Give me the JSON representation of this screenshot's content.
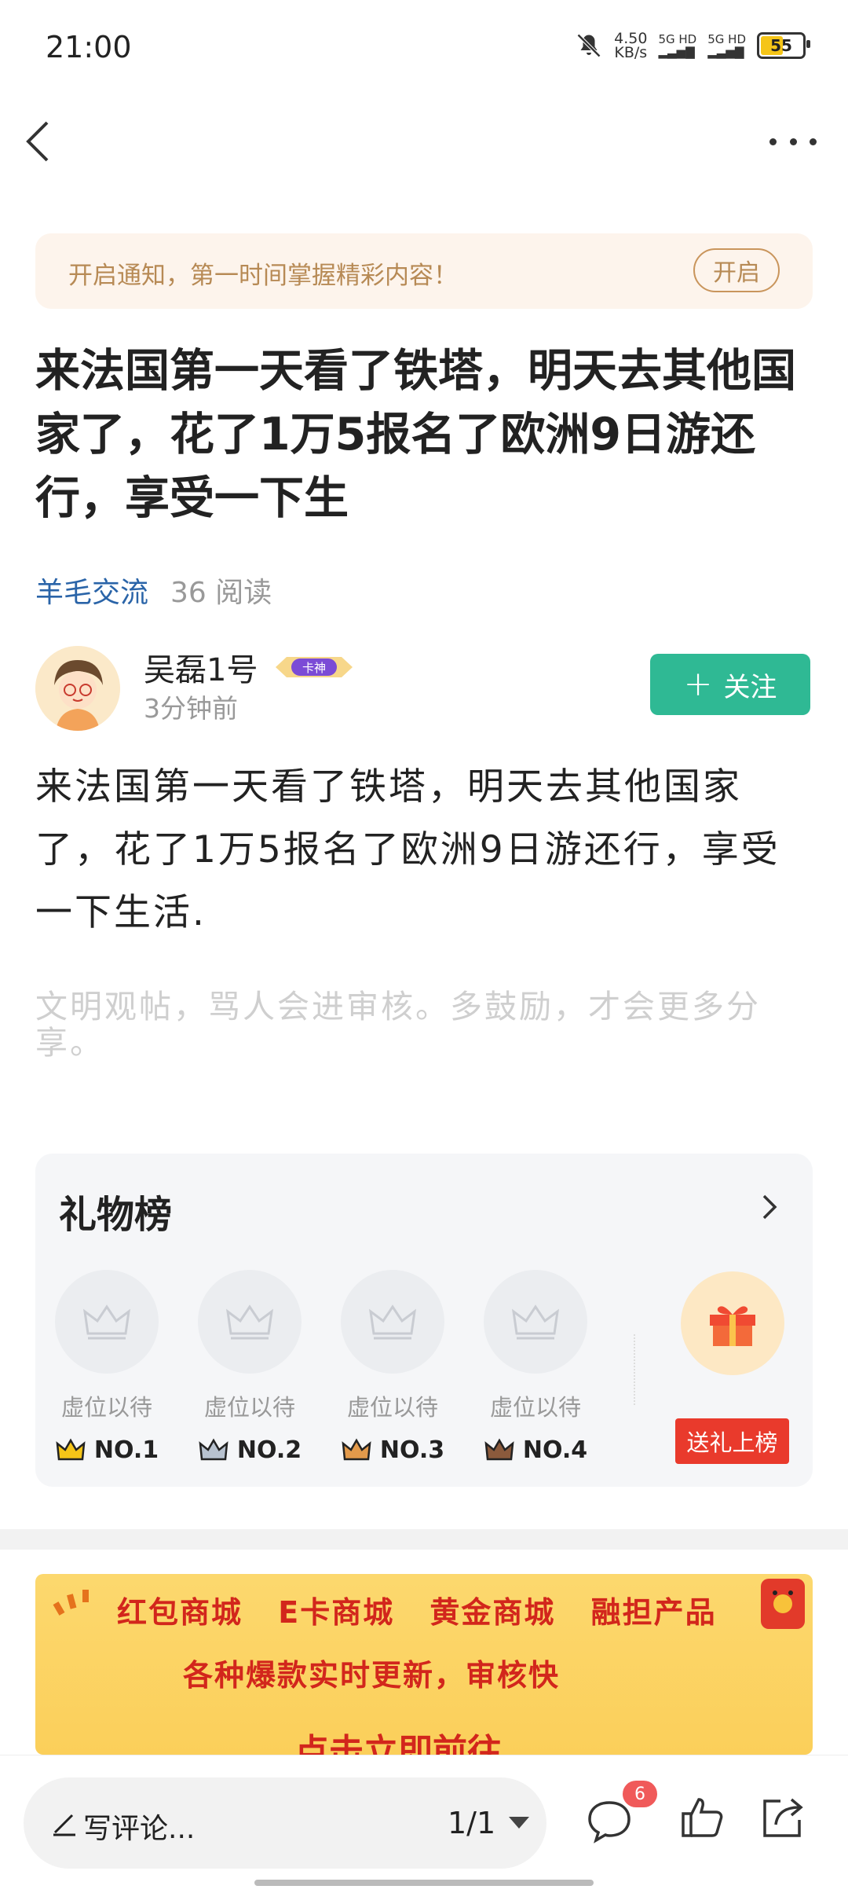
{
  "status": {
    "time": "21:00",
    "net_speed_value": "4.50",
    "net_speed_unit": "KB/s",
    "signal1": "5G HD",
    "signal2": "5G HD",
    "battery": "55"
  },
  "notify": {
    "text": "开启通知，第一时间掌握精彩内容！",
    "button": "开启"
  },
  "article": {
    "title": "来法国第一天看了铁塔，明天去其他国家了，花了1万5报名了欧洲9日游还行，享受一下生",
    "category": "羊毛交流",
    "reads": "36 阅读",
    "content": "来法国第一天看了铁塔，明天去其他国家了，花了1万5报名了欧洲9日游还行，享受一下生活.",
    "hint": "文明观帖，骂人会进审核。多鼓励，才会更多分享。"
  },
  "author": {
    "name": "吴磊1号",
    "badge": "卡神",
    "time": "3分钟前",
    "follow_label": "关注"
  },
  "gift_board": {
    "title": "礼物榜",
    "slots": [
      {
        "status": "虚位以待",
        "rank": "NO.1",
        "crown_color": "#f5c518"
      },
      {
        "status": "虚位以待",
        "rank": "NO.2",
        "crown_color": "#b8c2cf"
      },
      {
        "status": "虚位以待",
        "rank": "NO.3",
        "crown_color": "#e39a4b"
      },
      {
        "status": "虚位以待",
        "rank": "NO.4",
        "crown_color": "#8b5a3c"
      }
    ],
    "send_label": "送礼上榜"
  },
  "ad": {
    "row1": "红包商城 E卡商城 黄金商城 融担产品",
    "row2": "各种爆款实时更新，审核快",
    "row3": "点击立即前往"
  },
  "bottom": {
    "comment_placeholder": "写评论...",
    "page_indicator": "1/1",
    "comment_count": "6"
  },
  "colors": {
    "accent_green": "#2fb994",
    "link_blue": "#2a64a8",
    "notify_bg": "#fdf4ec",
    "gift_red": "#e93a2c"
  }
}
